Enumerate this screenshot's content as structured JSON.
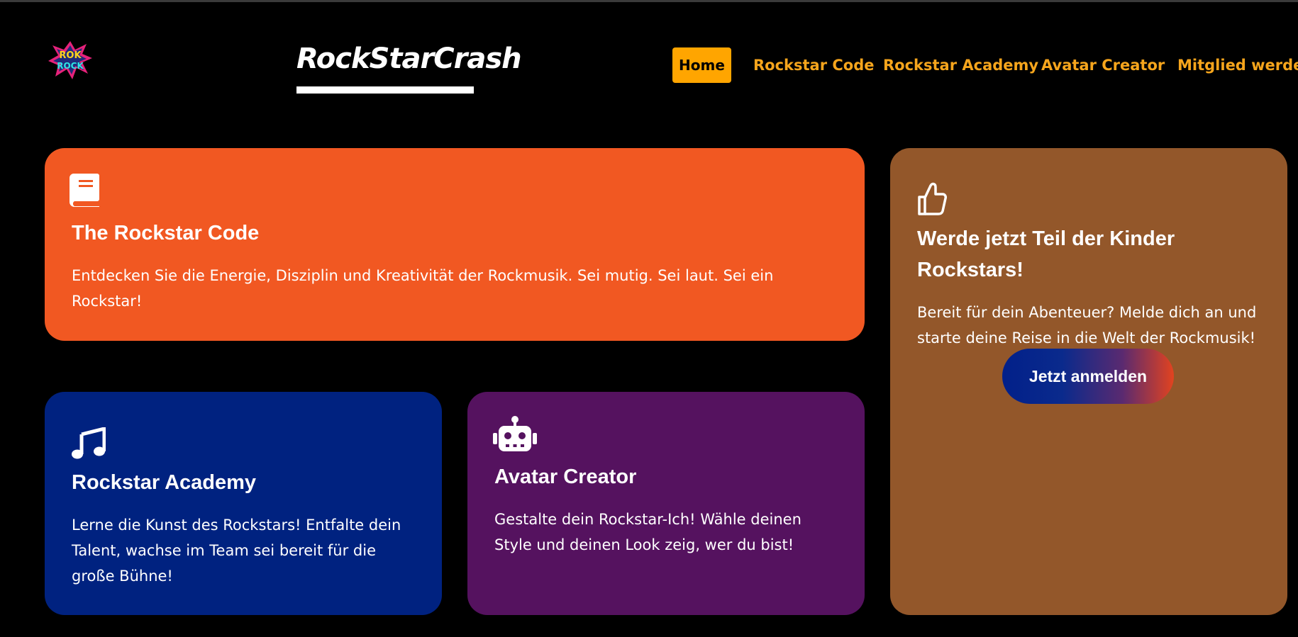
{
  "header": {
    "logo_text": "ROCK ROCK",
    "brand": "RockStarCrash"
  },
  "nav": {
    "items": [
      {
        "label": "Home",
        "active": true
      },
      {
        "label": "Rockstar Code",
        "active": false
      },
      {
        "label": "Rockstar Academy",
        "active": false
      },
      {
        "label": "Avatar Creator",
        "active": false
      },
      {
        "label": "Mitglied werden",
        "active": false
      }
    ]
  },
  "cards": {
    "code": {
      "icon": "book-icon",
      "title": "The Rockstar Code",
      "text": "Entdecken Sie die Energie, Disziplin und Kreativität der Rockmusik. Sei mutig. Sei laut. Sei ein Rockstar!"
    },
    "academy": {
      "icon": "music-note-icon",
      "title": "Rockstar Academy",
      "text": "Lerne die Kunst des Rockstars! Entfalte dein Talent, wachse im Team sei bereit für die große Bühne!"
    },
    "avatar": {
      "icon": "robot-icon",
      "title": "Avatar Creator",
      "text": "Gestalte dein Rockstar-Ich! Wähle deinen Style und deinen Look zeig, wer du bist!"
    },
    "join": {
      "icon": "thumbs-up-icon",
      "title": "Werde jetzt Teil der Kinder Rockstars!",
      "text": "Bereit für dein Abenteuer? Melde dich an und starte deine Reise in die Welt der Rockmusik!",
      "button": "Jetzt anmelden"
    }
  },
  "colors": {
    "background": "#000000",
    "nav_accent": "#f6a51c",
    "nav_active_bg": "#ffa500",
    "code_card": "#f15822",
    "academy_card": "#002280",
    "avatar_card": "#55125f",
    "join_card": "#93572a"
  }
}
